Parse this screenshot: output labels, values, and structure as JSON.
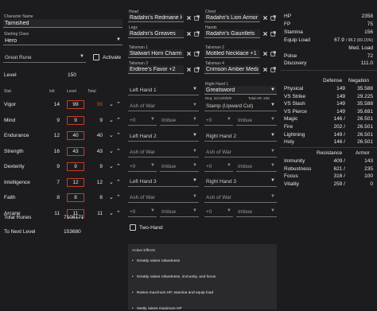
{
  "character": {
    "name_label": "Character Name",
    "name": "Tarnished",
    "class_label": "Starting Class",
    "class": "Hero",
    "rune": "Great Rune",
    "activate_label": "Activate",
    "level_label": "Level",
    "level": "150"
  },
  "stats_header": {
    "stat": "Stat",
    "init": "Init",
    "level": "Level",
    "total": "Total"
  },
  "stats": [
    {
      "name": "Vigor",
      "init": "14",
      "level": "99",
      "total": "99"
    },
    {
      "name": "Mind",
      "init": "9",
      "level": "9",
      "total": "9"
    },
    {
      "name": "Endurance",
      "init": "12",
      "level": "40",
      "total": "40"
    },
    {
      "name": "Strength",
      "init": "16",
      "level": "43",
      "total": "43"
    },
    {
      "name": "Dexterity",
      "init": "9",
      "level": "9",
      "total": "9"
    },
    {
      "name": "Intelligence",
      "init": "7",
      "level": "12",
      "total": "12"
    },
    {
      "name": "Faith",
      "init": "8",
      "level": "8",
      "total": "8"
    },
    {
      "name": "Arcane",
      "init": "11",
      "level": "11",
      "total": "11"
    }
  ],
  "totals": {
    "runes_label": "Total Runes",
    "runes": "7108171",
    "next_label": "To Next Level",
    "next": "153680"
  },
  "armor": {
    "head_label": "Head",
    "head": "Radahn's Redmane Helm",
    "chest_label": "Chest",
    "chest": "Radahn's Lion Armor",
    "legs_label": "Legs",
    "legs": "Radahn's Greaves",
    "hands_label": "Hands",
    "hands": "Radahn's Gauntlets"
  },
  "talismans": [
    {
      "label": "Talisman 1",
      "value": "Stalwart Horn Charm +1"
    },
    {
      "label": "Talisman 2",
      "value": "Mottled Necklace +1"
    },
    {
      "label": "Talisman 3",
      "value": "Erdtree's Favor +2"
    },
    {
      "label": "Talisman 4",
      "value": "Crimson Amber Medallion"
    }
  ],
  "weapons": {
    "lh1": "Left Hand 1",
    "lh2": "Left Hand 2",
    "lh3": "Left Hand 3",
    "rh1_label": "Right Hand 1",
    "rh1": "Greatsword",
    "rh1_req": "Req: 31/12/0/0/0",
    "rh1_ar": "Total AR: 225",
    "rh2": "Right Hand 2",
    "rh3": "Right Hand 3",
    "ash": "Ash of War",
    "plus": "+0",
    "imbue": "Imbue",
    "rh1_ash": "Stamp (Upward Cut)",
    "two_hand": "Two-Hand"
  },
  "effects": {
    "title": "Active Effects",
    "items": [
      "Greatly raises robustness",
      "Greatly raises robustness, immunity, and focus",
      "Raises maximum HP, stamina and equip load",
      "Vastly raises maximum HP"
    ]
  },
  "attributes": [
    {
      "label": "HP",
      "value": "2358"
    },
    {
      "label": "FP",
      "value": "75"
    },
    {
      "label": "Stamina",
      "value": "156"
    }
  ],
  "equip": {
    "label": "Equip Load",
    "value": "67.9",
    "detail": "/ 98.2 (69.15%)",
    "class": "Med. Load"
  },
  "poise": {
    "label": "Poise",
    "value": "72"
  },
  "discovery": {
    "label": "Discovery",
    "value": "111.0"
  },
  "defense_header": {
    "def": "Defense",
    "neg": "Negation"
  },
  "defense": [
    {
      "name": "Physical",
      "def": "149",
      "neg": "35.588"
    },
    {
      "name": "VS Strike",
      "def": "149",
      "neg": "29.225"
    },
    {
      "name": "VS Slash",
      "def": "149",
      "neg": "35.588"
    },
    {
      "name": "VS Pierce",
      "def": "149",
      "neg": "35.691"
    },
    {
      "name": "Magic",
      "def": "146 /",
      "neg": "26.501"
    },
    {
      "name": "Fire",
      "def": "202 /",
      "neg": "26.501"
    },
    {
      "name": "Lightning",
      "def": "149 /",
      "neg": "26.501"
    },
    {
      "name": "Holy",
      "def": "146 /",
      "neg": "26.501"
    }
  ],
  "resist_header": {
    "res": "Resistance",
    "armor": "Armor"
  },
  "resist": [
    {
      "name": "Immunity",
      "res": "409 /",
      "armor": "143"
    },
    {
      "name": "Robustness",
      "res": "621 /",
      "armor": "235"
    },
    {
      "name": "Focus",
      "res": "316 /",
      "armor": "100"
    },
    {
      "name": "Vitality",
      "res": "259 /",
      "armor": "0"
    }
  ],
  "colors": {
    "accent": "#c63a2a",
    "bg": "#1c1c1e",
    "panel": "#262629"
  }
}
